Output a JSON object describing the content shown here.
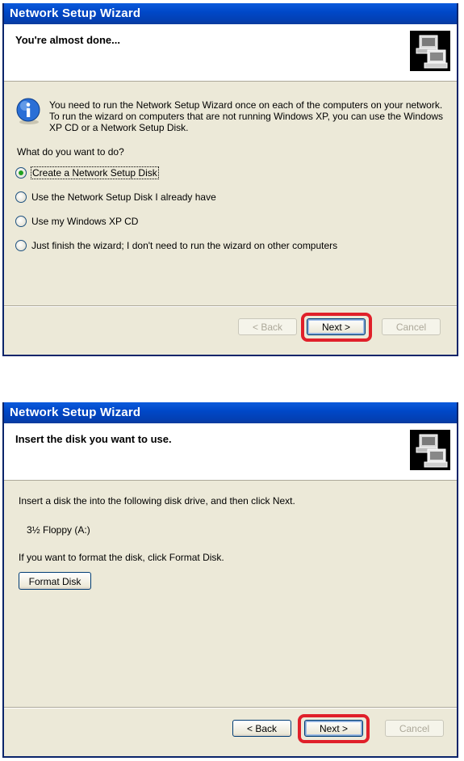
{
  "dialog1": {
    "title": "Network Setup Wizard",
    "header_title": "You're almost done...",
    "info_text": "You need to run the Network Setup Wizard once on each of the computers on your network. To run the wizard on computers that are not running Windows XP, you can use the Windows XP CD or a Network Setup Disk.",
    "prompt": "What do you want to do?",
    "options": [
      {
        "label": "Create a Network Setup Disk",
        "checked": true
      },
      {
        "label": "Use the Network Setup Disk I already have",
        "checked": false
      },
      {
        "label": "Use my Windows XP CD",
        "checked": false
      },
      {
        "label": "Just finish the wizard; I don't need to run the wizard on other computers",
        "checked": false
      }
    ],
    "buttons": {
      "back": "< Back",
      "next": "Next >",
      "cancel": "Cancel"
    }
  },
  "dialog2": {
    "title": "Network Setup Wizard",
    "header_title": "Insert the disk you want to use.",
    "instruction": "Insert a disk the into the following disk drive, and then click Next.",
    "drive": "3½ Floppy (A:)",
    "format_hint": "If you want to format the disk, click Format Disk.",
    "format_button": "Format Disk",
    "buttons": {
      "back": "< Back",
      "next": "Next >",
      "cancel": "Cancel"
    }
  },
  "colors": {
    "highlight": "#e0202a",
    "titlebar": "#0048c8",
    "dialog_bg": "#ece9d8"
  },
  "icons": [
    "computers-network-icon",
    "info-icon",
    "computers-network-icon"
  ]
}
